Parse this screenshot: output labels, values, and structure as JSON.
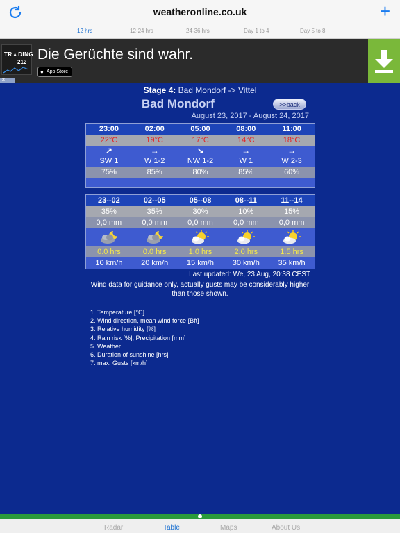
{
  "header": {
    "site_title": "weatheronline.co.uk",
    "refresh_icon": "refresh-icon",
    "add_icon": "plus-icon",
    "tabs": [
      "12 hrs",
      "12-24 hrs",
      "24-36 hrs",
      "Day 1 to 4",
      "Day 5 to 8"
    ],
    "active_tab": "12 hrs"
  },
  "ad": {
    "logo_line1": "TR▲DING",
    "logo_line2": "212",
    "headline": "Die Gerüchte sind wahr.",
    "store_badge": "App Store",
    "download_icon": "download-icon",
    "close_label": "✕"
  },
  "stage": {
    "label": "Stage 4:",
    "route": "Bad Mondorf -> Vittel"
  },
  "city": "Bad Mondorf",
  "back_label": ">>back",
  "date_range": "August 23, 2017 - August 24, 2017",
  "table1": {
    "times": [
      "23:00",
      "02:00",
      "05:00",
      "08:00",
      "11:00"
    ],
    "temperatures": [
      "22°C",
      "19°C",
      "17°C",
      "14°C",
      "18°C"
    ],
    "wind_arrows": [
      "↗",
      "→",
      "↘",
      "→",
      "→"
    ],
    "wind": [
      "SW 1",
      "W 1-2",
      "NW 1-2",
      "W 1",
      "W 2-3"
    ],
    "humidity": [
      "75%",
      "85%",
      "80%",
      "85%",
      "60%"
    ]
  },
  "table2": {
    "periods": [
      "23--02",
      "02--05",
      "05--08",
      "08--11",
      "11--14"
    ],
    "rain_risk": [
      "35%",
      "35%",
      "30%",
      "10%",
      "15%"
    ],
    "precipitation": [
      "0,0 mm",
      "0,0 mm",
      "0,0 mm",
      "0,0 mm",
      "0,0 mm"
    ],
    "weather_icons": [
      "moon-cloud-icon",
      "moon-cloud-icon",
      "sun-cloud-icon",
      "sun-cloud-icon",
      "sun-cloud-icon"
    ],
    "sunshine": [
      "0.0 hrs",
      "0.0 hrs",
      "1.0 hrs",
      "2.0 hrs",
      "1.5 hrs"
    ],
    "gusts": [
      "10 km/h",
      "20 km/h",
      "15 km/h",
      "30 km/h",
      "35 km/h"
    ]
  },
  "last_updated": "Last updated: We, 23 Aug, 20:38 CEST",
  "note": "Wind data for guidance only, actually gusts may be considerably higher than those shown.",
  "legend": [
    "1. Temperature [°C]",
    "2. Wind direction, mean wind force [Bft]",
    "3. Relative humidity [%]",
    "4. Rain risk [%], Precipitation [mm]",
    "5. Weather",
    "6. Duration of sunshine [hrs]",
    "7. max. Gusts [km/h]"
  ],
  "bottom_tabs": [
    "Radar",
    "Table",
    "Maps",
    "About Us"
  ],
  "active_bottom_tab": "Table",
  "colors": {
    "background": "#0c2a8f",
    "header_row": "#1d44b8",
    "temperature": "#e42424",
    "sunshine": "#f5e84a",
    "accent": "#1a7cf0"
  }
}
